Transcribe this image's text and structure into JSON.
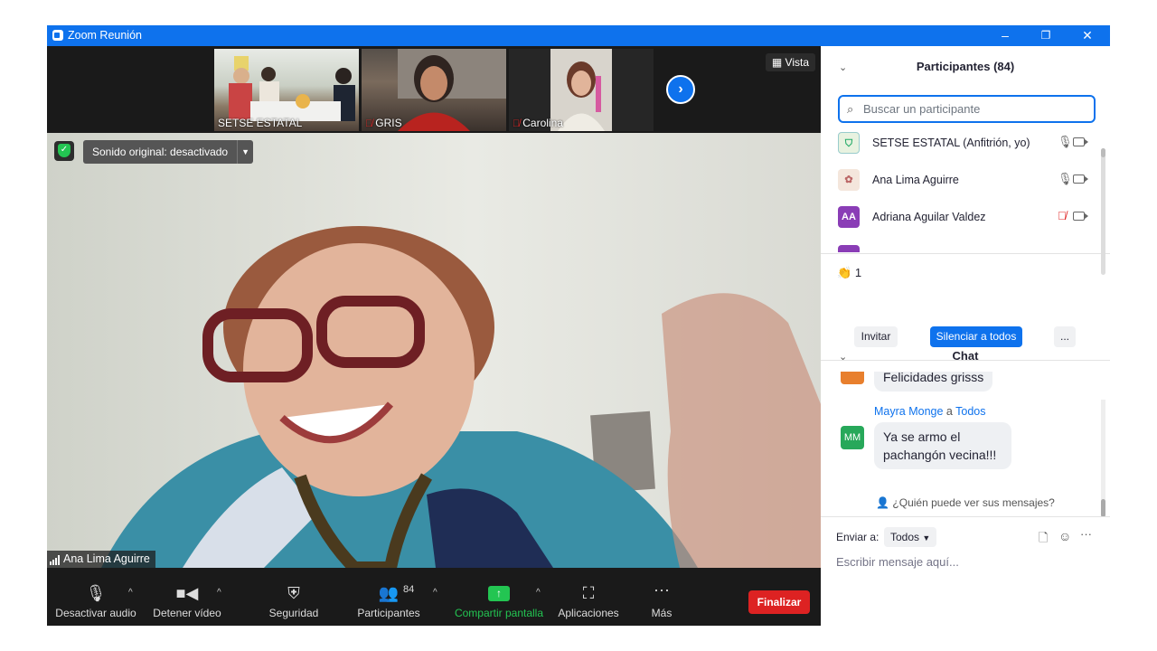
{
  "window": {
    "title": "Zoom Reunión",
    "minimize": "–",
    "restore": "❐",
    "close": "✕"
  },
  "gallery": {
    "thumbs": [
      {
        "name": "SETSE ESTATAL",
        "muted": false
      },
      {
        "name": "GRIS",
        "muted": true
      },
      {
        "name": "Carolina",
        "muted": true
      }
    ],
    "view_label": "Vista"
  },
  "main_video": {
    "sound_label": "Sonido original: desactivado",
    "speaker_name": "Ana Lima Aguirre"
  },
  "toolbar": {
    "mute": "Desactivar audio",
    "video": "Detener vídeo",
    "security": "Seguridad",
    "participants": "Participantes",
    "participants_count": "84",
    "share": "Compartir pantalla",
    "apps": "Aplicaciones",
    "more": "Más",
    "end": "Finalizar"
  },
  "participants_panel": {
    "title": "Participantes (84)",
    "search_placeholder": "Buscar un participante",
    "list": [
      {
        "name": "SETSE ESTATAL (Anfitrión, yo)",
        "initials": "",
        "muted": false
      },
      {
        "name": "Ana Lima Aguirre",
        "initials": "",
        "muted": false
      },
      {
        "name": "Adriana Aguilar Valdez",
        "initials": "AA",
        "muted": true
      }
    ],
    "reaction_count": "1",
    "invite": "Invitar",
    "mute_all": "Silenciar a todos",
    "more": "..."
  },
  "chat": {
    "title": "Chat",
    "prev_message": "Felicidades grisss",
    "sender": "Mayra Monge",
    "to_word": "a",
    "recipient": "Todos",
    "sender_initials": "MM",
    "message": "Ya se armo el pachangón vecina!!!",
    "visibility": "¿Quién puede ver sus mensajes?",
    "send_to_label": "Enviar a:",
    "send_to_value": "Todos",
    "input_placeholder": "Escribir mensaje aquí..."
  },
  "colors": {
    "accent": "#0e72ed",
    "danger": "#dd2222",
    "success": "#23c552",
    "avatar_purple": "#8a3db6",
    "avatar_green": "#27a85a"
  }
}
